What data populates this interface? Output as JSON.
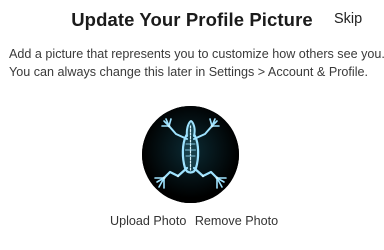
{
  "header": {
    "title": "Update Your Profile Picture",
    "skip_label": "Skip"
  },
  "description": {
    "line1": "Add a picture that represents you to customize how others see you.",
    "line2": "You can always change this later in Settings > Account & Profile."
  },
  "avatar": {
    "image": "frog-xray-picture",
    "background": "#000000",
    "glow_color": "#7fd8ff"
  },
  "actions": {
    "upload_label": "Upload Photo",
    "remove_label": "Remove Photo"
  }
}
